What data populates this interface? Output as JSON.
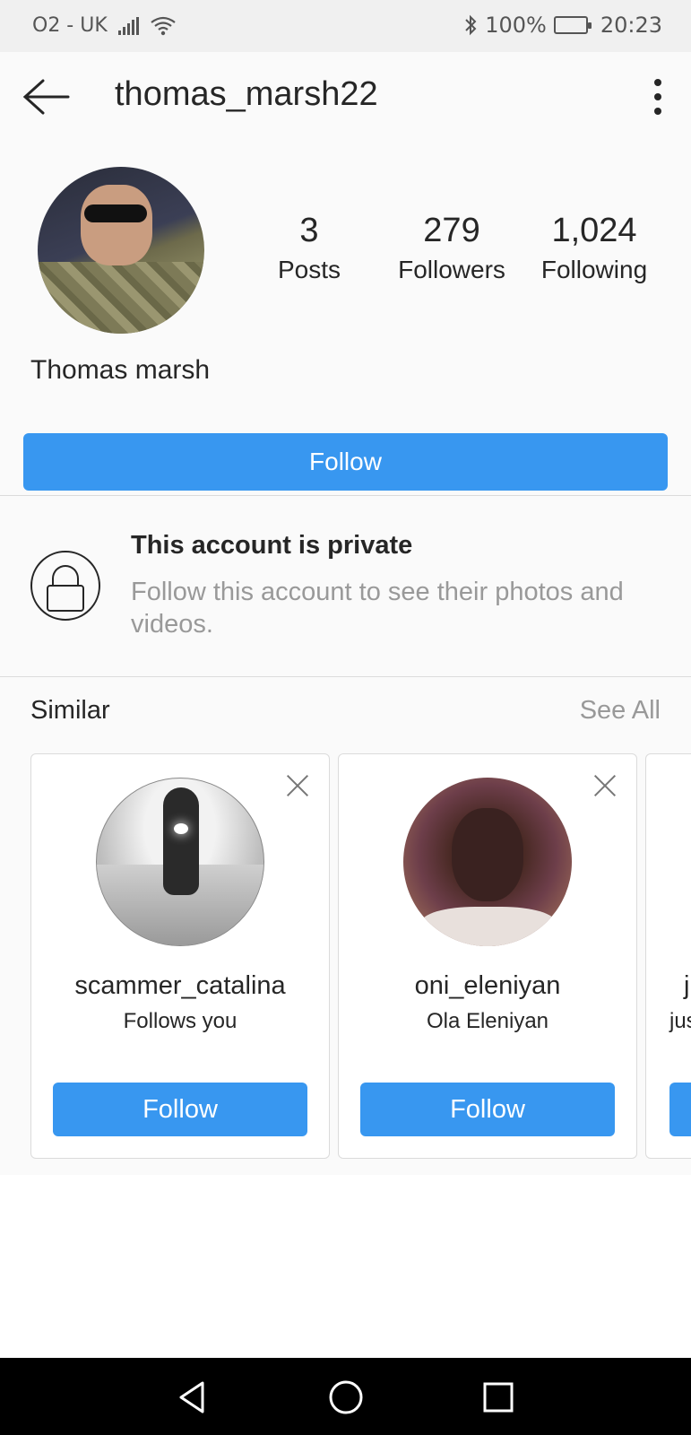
{
  "status_bar": {
    "carrier": "O2 - UK",
    "battery_percent": "100%",
    "time": "20:23"
  },
  "header": {
    "username": "thomas_marsh22"
  },
  "profile": {
    "stats": [
      {
        "value": "3",
        "label": "Posts"
      },
      {
        "value": "279",
        "label": "Followers"
      },
      {
        "value": "1,024",
        "label": "Following"
      }
    ],
    "full_name": "Thomas marsh",
    "follow_label": "Follow"
  },
  "private_notice": {
    "title": "This account is private",
    "description": "Follow this account to see their photos and videos."
  },
  "similar": {
    "label": "Similar",
    "see_all": "See All",
    "cards": [
      {
        "username": "scammer_catalina",
        "subtitle": "Follows you",
        "follow_label": "Follow"
      },
      {
        "username": "oni_eleniyan",
        "subtitle": "Ola Eleniyan",
        "follow_label": "Follow"
      },
      {
        "username": "j",
        "subtitle": "jus"
      }
    ]
  },
  "colors": {
    "accent": "#3897f0",
    "background": "#fafafa",
    "divider": "#dbdbdb"
  }
}
